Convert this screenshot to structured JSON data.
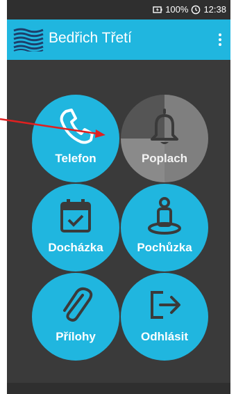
{
  "status": {
    "battery_text": "100%",
    "time": "12:38",
    "battery_icon": "battery-charging-icon",
    "clock_icon": "clock-icon"
  },
  "toolbar": {
    "title": "Bedřich Třetí",
    "menu_icon": "more-vert-icon",
    "logo": "company-logo"
  },
  "tiles": {
    "telefon": {
      "label": "Telefon",
      "icon": "phone-icon"
    },
    "poplach": {
      "label": "Poplach",
      "icon": "bell-icon"
    },
    "dochazka": {
      "label": "Docházka",
      "icon": "calendar-check-icon"
    },
    "pochuzka": {
      "label": "Pochůzka",
      "icon": "person-location-icon"
    },
    "prilohy": {
      "label": "Přílohy",
      "icon": "paperclip-icon"
    },
    "odhlasit": {
      "label": "Odhlásit",
      "icon": "logout-icon"
    }
  },
  "colors": {
    "accent": "#20b6df",
    "background": "#3a3a3a",
    "disabled": "#7f7f7f",
    "annotation": "#e02020"
  }
}
